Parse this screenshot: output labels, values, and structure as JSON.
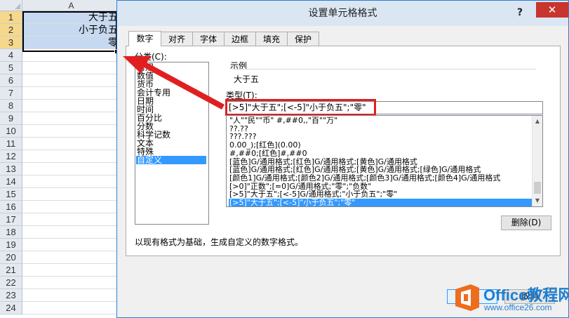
{
  "sheet": {
    "column_header": "A",
    "rows": [
      {
        "num": "1",
        "value": "大于五"
      },
      {
        "num": "2",
        "value": "小于负五"
      },
      {
        "num": "3",
        "value": "零"
      },
      {
        "num": "4",
        "value": ""
      },
      {
        "num": "5",
        "value": ""
      },
      {
        "num": "6",
        "value": ""
      },
      {
        "num": "7",
        "value": ""
      },
      {
        "num": "8",
        "value": ""
      },
      {
        "num": "9",
        "value": ""
      },
      {
        "num": "10",
        "value": ""
      },
      {
        "num": "11",
        "value": ""
      },
      {
        "num": "12",
        "value": ""
      },
      {
        "num": "13",
        "value": ""
      },
      {
        "num": "14",
        "value": ""
      },
      {
        "num": "15",
        "value": ""
      },
      {
        "num": "16",
        "value": ""
      },
      {
        "num": "17",
        "value": ""
      },
      {
        "num": "18",
        "value": ""
      },
      {
        "num": "19",
        "value": ""
      },
      {
        "num": "20",
        "value": ""
      },
      {
        "num": "21",
        "value": ""
      },
      {
        "num": "22",
        "value": ""
      },
      {
        "num": "23",
        "value": ""
      },
      {
        "num": "24",
        "value": ""
      }
    ]
  },
  "dialog": {
    "title": "设置单元格格式",
    "help_label": "?",
    "close_label": "✕",
    "tabs": [
      "数字",
      "对齐",
      "字体",
      "边框",
      "填充",
      "保护"
    ],
    "active_tab": "数字",
    "category_label": "分类(C):",
    "categories": [
      "常规",
      "数值",
      "货币",
      "会计专用",
      "日期",
      "时间",
      "百分比",
      "分数",
      "科学记数",
      "文本",
      "特殊",
      "自定义"
    ],
    "selected_category": "自定义",
    "sample_label": "示例",
    "sample_value": "大于五",
    "type_label": "类型(T):",
    "type_value": "[>5]\"大于五\";[<-5]\"小于负五\";\"零\"",
    "format_list": [
      "\"人\"\"民\"\"币\" #,##0,,\"百\"\"万\"",
      "??.??",
      "???.???",
      "0.00_);[红色](0.00)",
      "#,##0;[红色]#,##0",
      "[蓝色]G/通用格式;[红色]G/通用格式;[黄色]G/通用格式",
      "[蓝色]G/通用格式;[红色]G/通用格式;[黄色]G/通用格式;[绿色]G/通用格式",
      "[颜色1]G/通用格式;[颜色2]G/通用格式;[颜色3]G/通用格式;[颜色4]G/通用格式",
      "[>0]\"正数\";[=0]G/通用格式;\"零\";\"负数\"",
      "[>5]\"大于五\";[<-5]G/通用格式;\"小于负五\";\"零\"",
      "[>5]\"大于五\";[<-5]\"小于负五\";\"零\""
    ],
    "selected_format_index": 10,
    "scroll_up": "▲",
    "scroll_down": "▼",
    "delete_label": "删除(D)",
    "description": "以现有格式为基础，生成自定义的数字格式。",
    "ok_label": "",
    "cancel_label": "取消"
  },
  "watermark": {
    "brand": "Office教程网",
    "url": "www.office26.com"
  },
  "colors": {
    "accent": "#3399ff",
    "annotation_red": "#e02020",
    "selection_fill": "#c6d9f1",
    "watermark_blue": "#1e7fd0",
    "watermark_orange": "#ee6c1e"
  }
}
